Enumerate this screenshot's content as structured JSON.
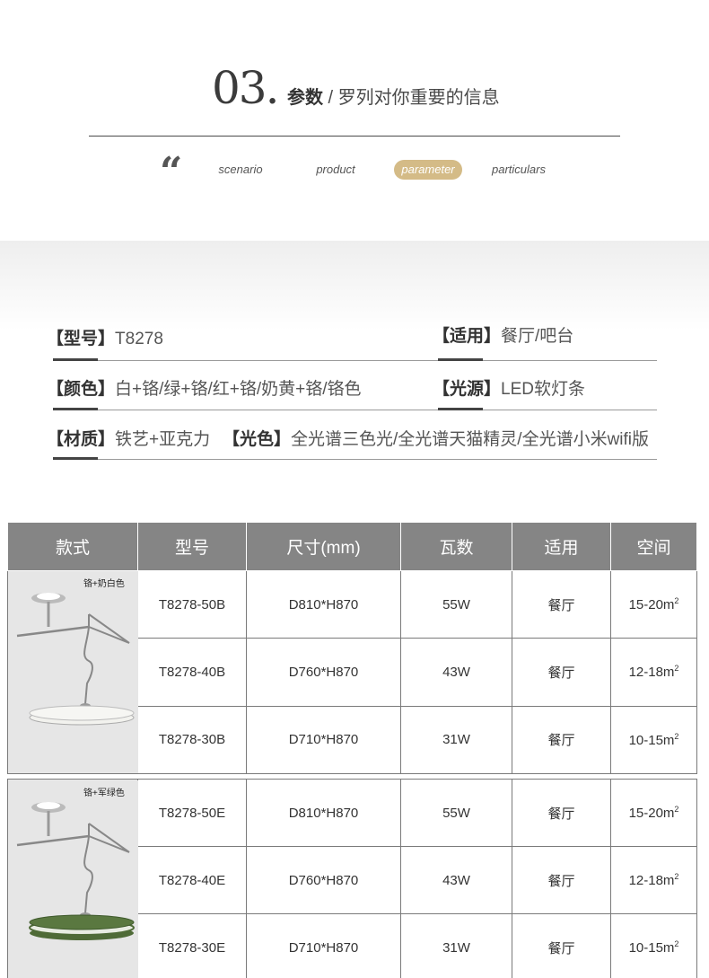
{
  "section": {
    "number": "03.",
    "title_bold": "参数",
    "title_rest": " / 罗列对你重要的信息"
  },
  "nav": {
    "quote_glyph": "“",
    "tabs": [
      "scenario",
      "product",
      "parameter",
      "particulars"
    ],
    "active": "parameter"
  },
  "specs": {
    "model": {
      "key": "【型号】",
      "value": "T8278"
    },
    "usage": {
      "key": "【适用】",
      "value": "餐厅/吧台"
    },
    "color": {
      "key": "【颜色】",
      "value": "白+铬/绿+铬/红+铬/奶黄+铬/铬色"
    },
    "source": {
      "key": "【光源】",
      "value": "LED软灯条"
    },
    "material": {
      "key": "【材质】",
      "value": "铁艺+亚克力"
    },
    "light": {
      "key": "【光色】",
      "value": "全光谱三色光/全光谱天猫精灵/全光谱小米wifi版"
    }
  },
  "table": {
    "headers": [
      "款式",
      "型号",
      "尺寸(mm)",
      "瓦数",
      "适用",
      "空间"
    ],
    "groups": [
      {
        "style_label": "铬+奶白色",
        "shade_color": "#f2f2ee",
        "rows": [
          {
            "model": "T8278-50B",
            "size": "D810*H870",
            "watt": "55W",
            "use": "餐厅",
            "space": "15-20m",
            "unit_sup": "2"
          },
          {
            "model": "T8278-40B",
            "size": "D760*H870",
            "watt": "43W",
            "use": "餐厅",
            "space": "12-18m",
            "unit_sup": "2"
          },
          {
            "model": "T8278-30B",
            "size": "D710*H870",
            "watt": "31W",
            "use": "餐厅",
            "space": "10-15m",
            "unit_sup": "2"
          }
        ]
      },
      {
        "style_label": "铬+军绿色",
        "shade_color": "#4f6b37",
        "rows": [
          {
            "model": "T8278-50E",
            "size": "D810*H870",
            "watt": "55W",
            "use": "餐厅",
            "space": "15-20m",
            "unit_sup": "2"
          },
          {
            "model": "T8278-40E",
            "size": "D760*H870",
            "watt": "43W",
            "use": "餐厅",
            "space": "12-18m",
            "unit_sup": "2"
          },
          {
            "model": "T8278-30E",
            "size": "D710*H870",
            "watt": "31W",
            "use": "餐厅",
            "space": "10-15m",
            "unit_sup": "2"
          }
        ]
      }
    ]
  }
}
